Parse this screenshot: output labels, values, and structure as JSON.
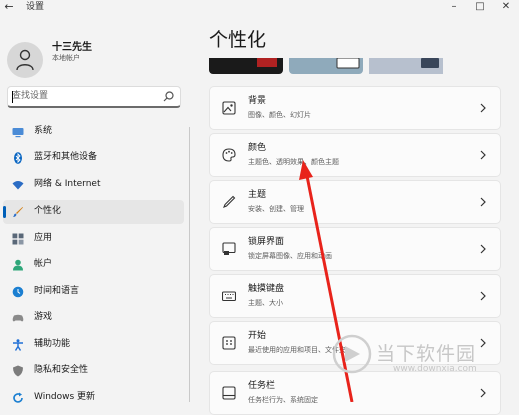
{
  "window": {
    "title": "设置",
    "back_icon": "back-arrow-icon",
    "controls": [
      "–",
      "□",
      "✕"
    ]
  },
  "user": {
    "name": "十三先生",
    "account_type": "本地帐户"
  },
  "search": {
    "placeholder": "查找设置"
  },
  "sidebar": {
    "items": [
      {
        "label": "系统",
        "icon": "monitor-icon",
        "color": "#4a8bd6"
      },
      {
        "label": "蓝牙和其他设备",
        "icon": "bluetooth-icon",
        "color": "#0a66c2"
      },
      {
        "label": "网络 & Internet",
        "icon": "wifi-icon",
        "color": "#2b6cc4"
      },
      {
        "label": "个性化",
        "icon": "brush-icon",
        "color": "#d4821a",
        "active": true
      },
      {
        "label": "应用",
        "icon": "apps-icon",
        "color": "#5a6878"
      },
      {
        "label": "帐户",
        "icon": "person-icon",
        "color": "#2fa77a"
      },
      {
        "label": "时间和语言",
        "icon": "globe-clock-icon",
        "color": "#1b7fd1"
      },
      {
        "label": "游戏",
        "icon": "gamepad-icon",
        "color": "#8a8a8a"
      },
      {
        "label": "辅助功能",
        "icon": "accessibility-icon",
        "color": "#1f6fd6"
      },
      {
        "label": "隐私和安全性",
        "icon": "shield-icon",
        "color": "#7c7c7c"
      },
      {
        "label": "Windows 更新",
        "icon": "update-icon",
        "color": "#1b7fd1"
      }
    ]
  },
  "main": {
    "title": "个性化",
    "cards": [
      {
        "title": "背景",
        "desc": "图像、颜色、幻灯片",
        "icon": "image-icon"
      },
      {
        "title": "颜色",
        "desc": "主题色、透明效果、颜色主题",
        "icon": "palette-icon"
      },
      {
        "title": "主题",
        "desc": "安装、创建、管理",
        "icon": "pen-icon"
      },
      {
        "title": "锁屏界面",
        "desc": "锁定屏幕图像、应用和动画",
        "icon": "lock-screen-icon"
      },
      {
        "title": "触摸键盘",
        "desc": "主题、大小",
        "icon": "keyboard-icon"
      },
      {
        "title": "开始",
        "desc": "最近使用的应用和项目、文件夹",
        "icon": "start-icon"
      },
      {
        "title": "任务栏",
        "desc": "任务栏行为、系统固定",
        "icon": "taskbar-icon"
      }
    ]
  },
  "watermark": {
    "name": "当下软件园",
    "url": "www.downxia.com"
  },
  "colors": {
    "accent": "#005fb8",
    "annotation_arrow": "#e8231b"
  }
}
